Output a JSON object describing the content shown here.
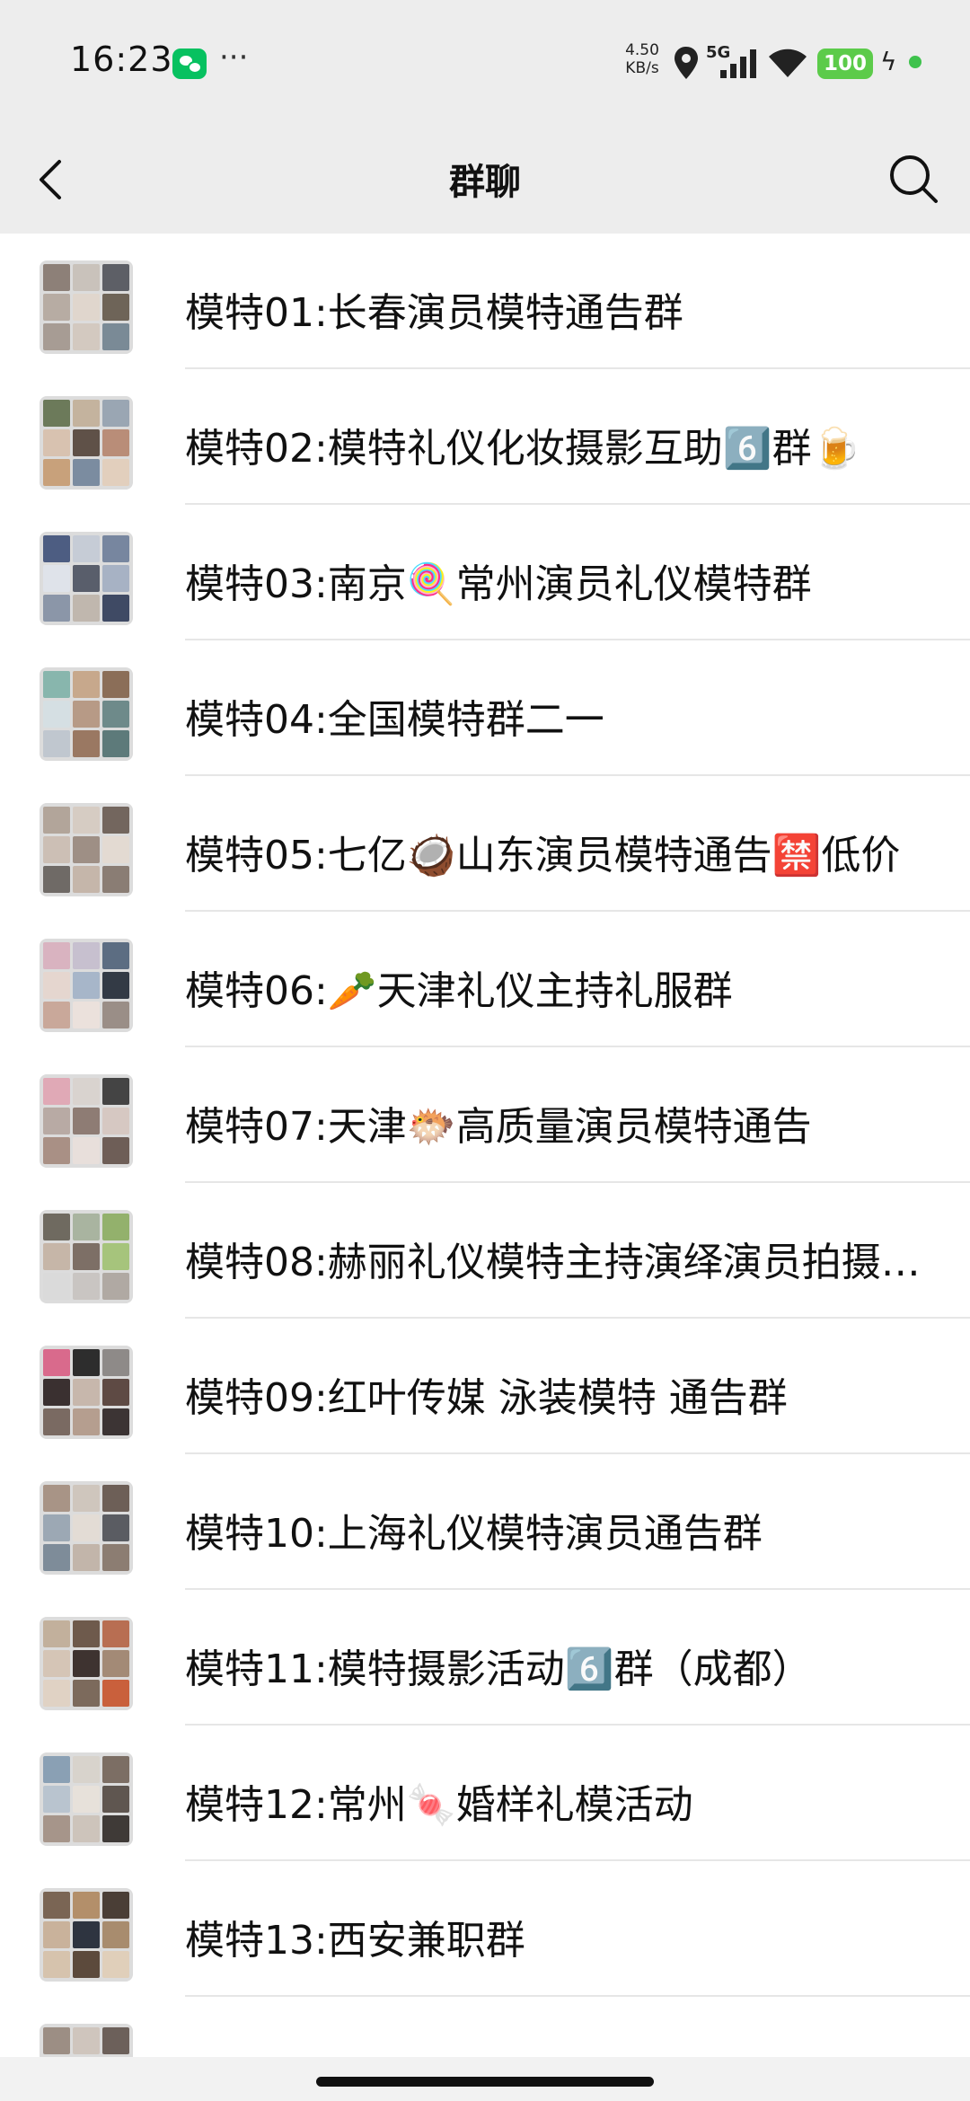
{
  "status_bar": {
    "time": "16:23",
    "more": "···",
    "net_speed_value": "4.50",
    "net_speed_unit": "KB/s",
    "network": "5G",
    "battery": "100",
    "icons": [
      "wechat-icon",
      "location-icon",
      "signal-icon",
      "wifi-icon",
      "charging-icon"
    ]
  },
  "nav": {
    "title": "群聊",
    "icons": [
      "back-icon",
      "search-icon"
    ]
  },
  "groups": [
    {
      "name": "模特01:长春演员模特通告群"
    },
    {
      "name": "模特02:模特礼仪化妆摄影互助6️⃣群🍺"
    },
    {
      "name": "模特03:南京🍭常州演员礼仪模特群"
    },
    {
      "name": "模特04:全国模特群二一"
    },
    {
      "name": "模特05:七亿🥥山东演员模特通告🈲低价"
    },
    {
      "name": "模特06:🥕天津礼仪主持礼服群"
    },
    {
      "name": "模特07:天津🐡高质量演员模特通告"
    },
    {
      "name": "模特08:赫丽礼仪模特主持演绎演员拍摄…"
    },
    {
      "name": "模特09:红叶传媒  泳装模特 通告群"
    },
    {
      "name": "模特10:上海礼仪模特演员通告群"
    },
    {
      "name": "模特11:模特摄影活动6️⃣群（成都）"
    },
    {
      "name": "模特12:常州🍬婚样礼模活动"
    },
    {
      "name": "模特13:西安兼职群"
    },
    {
      "name": ""
    }
  ],
  "colors": {
    "header_bg": "#ededed",
    "list_bg": "#ffffff",
    "wechat_green": "#07c160",
    "battery_green": "#5ccb4a"
  }
}
